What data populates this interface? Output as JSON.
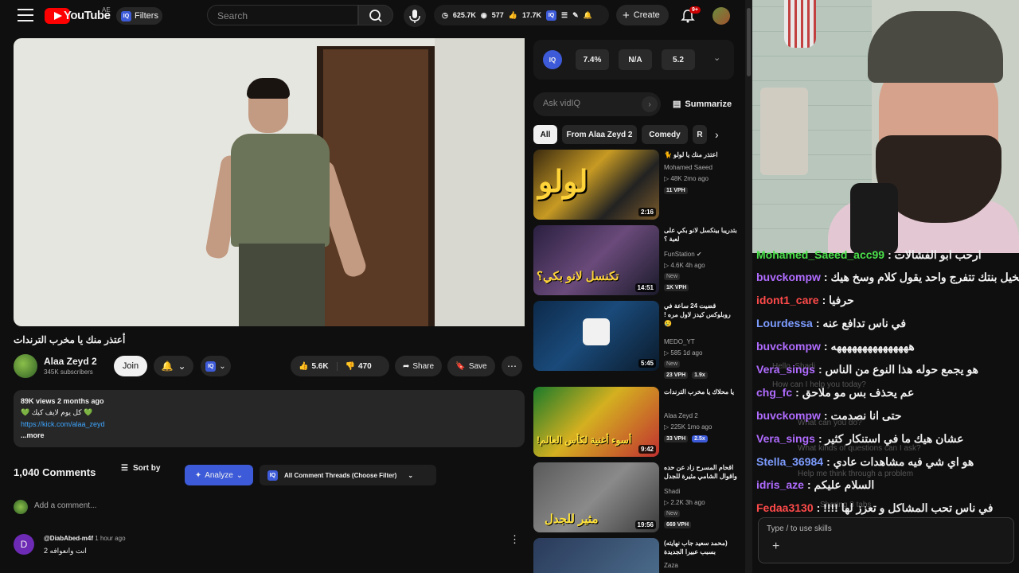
{
  "header": {
    "logo_word": "YouTube",
    "country_code": "AE",
    "filters_label": "Filters",
    "iq_label": "IQ",
    "search_placeholder": "Search",
    "stats": {
      "views": "625.7K",
      "watching": "577",
      "likes": "17.7K"
    },
    "create_label": "Create",
    "notifications": "9+"
  },
  "video": {
    "title": "أعتذر منك يا مخرب الترندات",
    "channel": "Alaa Zeyd 2",
    "subscribers": "345K subscribers",
    "join_label": "Join",
    "likes": "5.6K",
    "dislikes": "470",
    "share_label": "Share",
    "save_label": "Save"
  },
  "description": {
    "meta": "89K views  2 months ago",
    "line1": "💚 كل يوم لايف كيك 💚",
    "link": "https://kick.com/alaa_zeyd",
    "more": "...more"
  },
  "comments": {
    "count": "1,040 Comments",
    "sort_label": "Sort by",
    "analyze_label": "Analyze",
    "thread_filter": "All Comment Threads (Choose Filter)",
    "add_placeholder": "Add a comment...",
    "first": {
      "avatar_letter": "D",
      "user": "@DiabAbed-m4f",
      "time": "1 hour ago",
      "text": "انت وانعوافه 2"
    }
  },
  "vidiq": {
    "iq_label": "IQ",
    "metrics": [
      "7.4%",
      "N/A",
      "5.2"
    ],
    "ask_placeholder": "Ask vidIQ",
    "summarize_label": "Summarize"
  },
  "chips": [
    "All",
    "From Alaa Zeyd 2",
    "Comedy",
    "R"
  ],
  "recommendations": [
    {
      "title": "اعتذر منك يا لولو 🐈",
      "channel": "Mohamed Saeed",
      "meta": "▷ 48K  2mo ago",
      "vph": "11 VPH",
      "duration": "2:16",
      "thumb_text": "لولو",
      "new": ""
    },
    {
      "title": "بتدريبا بينكسل لانو بكي على لعبة ؟",
      "channel": "FunStation ✔",
      "meta": "▷ 4.6K  4h ago",
      "vph": "1K VPH",
      "duration": "14:51",
      "thumb_text": "تكنسل لانو بكي؟",
      "new": "New"
    },
    {
      "title": "قضيت 24 ساعة في روبلوكس كيدز لاول مره ! 😢",
      "channel": "MEDO_YT",
      "meta": "▷ 585  1d ago",
      "vph": "23 VPH",
      "duration": "5:45",
      "thumb_text": "",
      "new": "New",
      "ratio": "1.9x"
    },
    {
      "title": "يا محلاك يا مخرب الترندات",
      "channel": "Alaa Zeyd 2",
      "meta": "▷ 225K  1mo ago",
      "vph": "33 VPH",
      "duration": "9:42",
      "thumb_text": "أسوء أغنية لكأس العالم!",
      "new": "",
      "ratio": "2.5x"
    },
    {
      "title": "اقحام المسرح زاد عن حده واقوال الشامي مثيرة للجدل",
      "channel": "Shadi",
      "meta": "▷ 2.2K  3h ago",
      "vph": "669 VPH",
      "duration": "19:56",
      "thumb_text": "مثير للجدل",
      "new": "New"
    },
    {
      "title": "(محمد سعيد جاب نهايته) بسبب عبيرا الجديدة",
      "channel": "Zaza",
      "meta": "",
      "vph": "",
      "duration": "",
      "thumb_text": "",
      "new": ""
    }
  ],
  "chat": {
    "lines": [
      {
        "user": "Mohamed_Saeed_acc99",
        "color": "#4be04b",
        "msg": "ارحب ابو الفشالات"
      },
      {
        "user": "buvckompw",
        "color": "#b06cff",
        "msg": "تخيل بنتك تتفرج واحد يقول كلام وسخ هيك"
      },
      {
        "user": "idont1_care",
        "color": "#ff4a4a",
        "msg": "حرفيا"
      },
      {
        "user": "Lourdessa",
        "color": "#7d9cff",
        "msg": "في ناس تدافع عنه"
      },
      {
        "user": "buvckompw",
        "color": "#b06cff",
        "msg": "هههههههههههههههه"
      },
      {
        "user": "Vera_sings",
        "color": "#b06cff",
        "msg": "هو يجمع حوله هذا النوع من الناس"
      },
      {
        "user": "chg_fc",
        "color": "#b06cff",
        "msg": "عم يحذف بس مو ملاحق"
      },
      {
        "user": "buvckompw",
        "color": "#b06cff",
        "msg": "حتى انا نصدمت"
      },
      {
        "user": "Vera_sings",
        "color": "#b06cff",
        "msg": "عشان هيك ما في استنكار كثير"
      },
      {
        "user": "Stella_36984",
        "color": "#7d9cff",
        "msg": "هو اي شي فيه مشاهدات عادي"
      },
      {
        "user": "idris_aze",
        "color": "#b06cff",
        "msg": "السلام عليكم"
      },
      {
        "user": "Fedaa3130",
        "color": "#ff4a4a",
        "msg": "في ناس تحب المشاكل و تعزز لها !!!!"
      }
    ],
    "ghost_texts": [
      "Hello, Shadi",
      "How can I help you today?",
      "What can you do?",
      "What kinds of questions can I ask?",
      "Help me think through a problem",
      "Sharing 3 tabs"
    ],
    "input_placeholder": "Type / to use skills"
  }
}
